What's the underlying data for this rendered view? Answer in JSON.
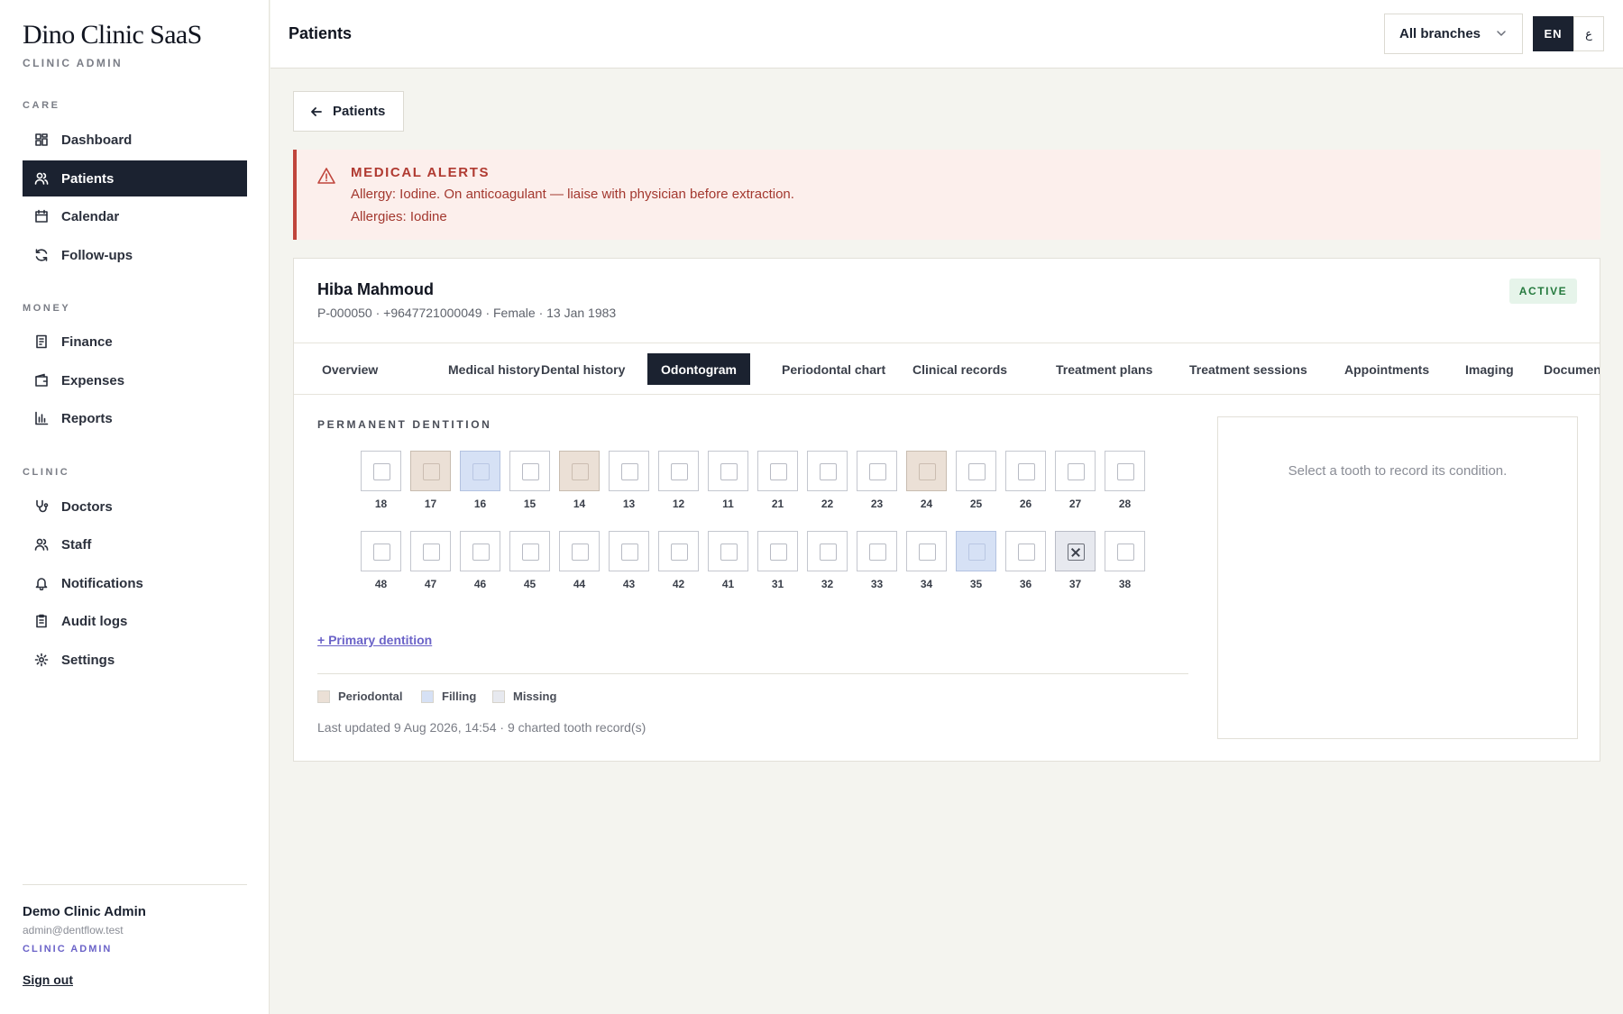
{
  "sidebar": {
    "brand": "Dino Clinic SaaS",
    "brand_sub": "CLINIC ADMIN",
    "sections": {
      "care": "CARE",
      "money": "MONEY",
      "clinic": "CLINIC"
    },
    "items": [
      {
        "label": "Dashboard",
        "icon": "grid-icon"
      },
      {
        "label": "Patients",
        "icon": "users-icon",
        "active": true
      },
      {
        "label": "Calendar",
        "icon": "calendar-icon"
      },
      {
        "label": "Follow-ups",
        "icon": "refresh-icon"
      },
      {
        "label": "Finance",
        "icon": "invoice-icon"
      },
      {
        "label": "Expenses",
        "icon": "wallet-icon"
      },
      {
        "label": "Reports",
        "icon": "bar-chart-icon"
      },
      {
        "label": "Doctors",
        "icon": "stethoscope-icon"
      },
      {
        "label": "Staff",
        "icon": "users-icon"
      },
      {
        "label": "Notifications",
        "icon": "bell-icon"
      },
      {
        "label": "Audit logs",
        "icon": "clipboard-icon"
      },
      {
        "label": "Settings",
        "icon": "gear-icon"
      }
    ],
    "user": {
      "name": "Demo Clinic Admin",
      "email": "admin@dentflow.test",
      "role": "CLINIC ADMIN",
      "sign_out": "Sign out"
    }
  },
  "topbar": {
    "title": "Patients",
    "branch": "All branches",
    "lang_en": "EN",
    "lang_ar": "ع"
  },
  "back_button": "Patients",
  "alert": {
    "title": "MEDICAL ALERTS",
    "line1": "Allergy: Iodine. On anticoagulant — liaise with physician before extraction.",
    "line2": "Allergies: Iodine",
    "color": "#c0453c"
  },
  "patient": {
    "name": "Hiba Mahmoud",
    "meta": "P-000050 · +9647721000049 · Female · 13 Jan 1983",
    "status": "ACTIVE"
  },
  "tabs": [
    {
      "label": "Overview"
    },
    {
      "label": "Medical history"
    },
    {
      "label": "Dental history"
    },
    {
      "label": "Odontogram",
      "active": true
    },
    {
      "label": "Periodontal chart"
    },
    {
      "label": "Clinical records"
    },
    {
      "label": "Treatment plans"
    },
    {
      "label": "Treatment sessions"
    },
    {
      "label": "Appointments"
    },
    {
      "label": "Imaging"
    },
    {
      "label": "Document"
    }
  ],
  "odontogram": {
    "section_label": "PERMANENT DENTITION",
    "upper": [
      {
        "n": "18",
        "s": ""
      },
      {
        "n": "17",
        "s": "periodontal"
      },
      {
        "n": "16",
        "s": "filling"
      },
      {
        "n": "15",
        "s": ""
      },
      {
        "n": "14",
        "s": "periodontal"
      },
      {
        "n": "13",
        "s": ""
      },
      {
        "n": "12",
        "s": ""
      },
      {
        "n": "11",
        "s": ""
      },
      {
        "n": "21",
        "s": ""
      },
      {
        "n": "22",
        "s": ""
      },
      {
        "n": "23",
        "s": ""
      },
      {
        "n": "24",
        "s": "periodontal"
      },
      {
        "n": "25",
        "s": ""
      },
      {
        "n": "26",
        "s": ""
      },
      {
        "n": "27",
        "s": ""
      },
      {
        "n": "28",
        "s": ""
      }
    ],
    "lower": [
      {
        "n": "48",
        "s": ""
      },
      {
        "n": "47",
        "s": ""
      },
      {
        "n": "46",
        "s": ""
      },
      {
        "n": "45",
        "s": ""
      },
      {
        "n": "44",
        "s": ""
      },
      {
        "n": "43",
        "s": ""
      },
      {
        "n": "42",
        "s": ""
      },
      {
        "n": "41",
        "s": ""
      },
      {
        "n": "31",
        "s": ""
      },
      {
        "n": "32",
        "s": ""
      },
      {
        "n": "33",
        "s": ""
      },
      {
        "n": "34",
        "s": ""
      },
      {
        "n": "35",
        "s": "filling"
      },
      {
        "n": "36",
        "s": ""
      },
      {
        "n": "37",
        "s": "missing"
      },
      {
        "n": "38",
        "s": ""
      }
    ],
    "primary_link": "+ Primary dentition",
    "legend": [
      {
        "label": "Periodontal",
        "color": "#ebe0d6"
      },
      {
        "label": "Filling",
        "color": "#d6e1f5"
      },
      {
        "label": "Missing",
        "color": "#e7e9ef"
      }
    ],
    "last_updated": "Last updated 9 Aug 2026, 14:54 · 9 charted tooth record(s)",
    "detail_hint": "Select a tooth to record its condition."
  }
}
